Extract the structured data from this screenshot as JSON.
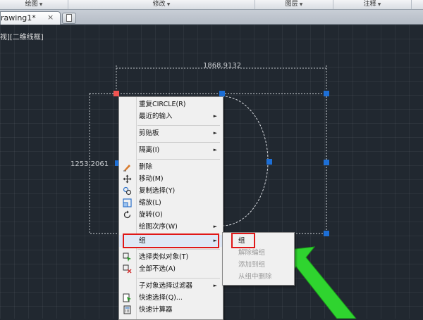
{
  "ribbon": {
    "panels": [
      {
        "label": "绘图",
        "id": "draw"
      },
      {
        "label": "修改",
        "id": "modify"
      },
      {
        "label": "图层",
        "id": "layers"
      },
      {
        "label": "注释",
        "id": "annotate"
      }
    ]
  },
  "document_tab": {
    "title": "rawing1*",
    "close": "×"
  },
  "viewport": {
    "view_label": "视][二维线框]",
    "dimension_horizontal": "1868.9132",
    "dimension_vertical": "1253.2061"
  },
  "context_menu": {
    "items": [
      {
        "label": "重复CIRCLE(R)",
        "submenu": false,
        "icon": ""
      },
      {
        "label": "最近的输入",
        "submenu": true,
        "icon": ""
      },
      {
        "label": "剪贴板",
        "submenu": true,
        "icon": ""
      },
      {
        "label": "隔离(I)",
        "submenu": true,
        "icon": ""
      },
      {
        "label": "删除",
        "submenu": false,
        "icon": "eraser-icon"
      },
      {
        "label": "移动(M)",
        "submenu": false,
        "icon": "move-icon"
      },
      {
        "label": "复制选择(Y)",
        "submenu": false,
        "icon": "copy-icon"
      },
      {
        "label": "缩放(L)",
        "submenu": false,
        "icon": "scale-icon"
      },
      {
        "label": "旋转(O)",
        "submenu": false,
        "icon": "rotate-icon"
      },
      {
        "label": "绘图次序(W)",
        "submenu": true,
        "icon": ""
      },
      {
        "label": "组",
        "submenu": true,
        "icon": ""
      },
      {
        "label": "选择类似对象(T)",
        "submenu": false,
        "icon": "select-similar-icon"
      },
      {
        "label": "全部不选(A)",
        "submenu": false,
        "icon": "deselect-all-icon"
      },
      {
        "label": "子对象选择过滤器",
        "submenu": true,
        "icon": ""
      },
      {
        "label": "快速选择(Q)...",
        "submenu": false,
        "icon": "quick-select-icon"
      },
      {
        "label": "快速计算器",
        "submenu": false,
        "icon": "calculator-icon"
      }
    ]
  },
  "group_submenu": {
    "items": [
      {
        "label": "组",
        "enabled": true
      },
      {
        "label": "解除编组",
        "enabled": false
      },
      {
        "label": "添加到组",
        "enabled": false
      },
      {
        "label": "从组中删除",
        "enabled": false
      }
    ]
  },
  "colors": {
    "viewport_bg": "#212830",
    "grip": "#1d6fd6",
    "hot_grip": "#ef5350",
    "highlight_box": "#e01818",
    "pointer_arrow": "#2fd42f"
  }
}
